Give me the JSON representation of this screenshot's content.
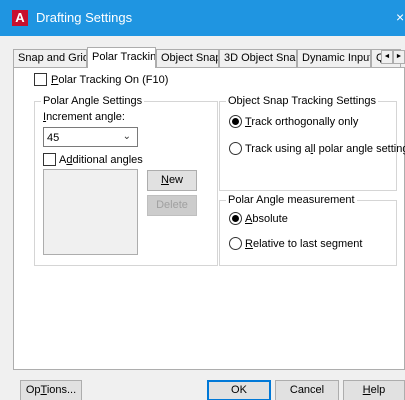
{
  "window": {
    "title": "Drafting Settings",
    "app_icon_letter": "A",
    "close_glyph": "×",
    "title_bar_color": "#1f95e1"
  },
  "tabs": [
    {
      "label": "Snap and Grid",
      "active": false
    },
    {
      "label": "Polar Tracking",
      "active": true
    },
    {
      "label": "Object Snap",
      "active": false
    },
    {
      "label": "3D Object Snap",
      "active": false
    },
    {
      "label": "Dynamic Input",
      "active": false
    },
    {
      "label": "Quic",
      "active": false
    }
  ],
  "tab_scroll": {
    "left": "◄",
    "right": "►"
  },
  "polar_tracking_on": {
    "checked": false,
    "mnemonic": "P",
    "rest": "olar Tracking On (F10)"
  },
  "polar_angle_settings": {
    "title": "Polar Angle Settings",
    "increment_label_mnemonic": "I",
    "increment_label_rest": "ncrement angle:",
    "increment_value": "45",
    "additional_angles": {
      "checked": false,
      "prefix": "A",
      "mnemonic": "d",
      "rest": "ditional angles"
    },
    "new_button": {
      "mnemonic": "N",
      "rest": "ew"
    },
    "delete_button": {
      "label": "Delete",
      "enabled": false
    }
  },
  "object_snap_tracking": {
    "title": "Object Snap Tracking Settings",
    "options": [
      {
        "prefix": "",
        "mnemonic": "T",
        "rest": "rack orthogonally only",
        "selected": true
      },
      {
        "prefix": "Track using a",
        "mnemonic": "l",
        "rest": "l polar angle settings",
        "selected": false
      }
    ]
  },
  "polar_angle_measurement": {
    "title": "Polar Angle measurement",
    "options": [
      {
        "mnemonic": "A",
        "rest": "bsolute",
        "selected": true
      },
      {
        "mnemonic": "R",
        "rest": "elative to last segment",
        "selected": false
      }
    ]
  },
  "footer": {
    "options_button": {
      "mnemonic": "T",
      "prefix": "Op",
      "rest": "ions..."
    },
    "ok_label": "OK",
    "cancel_label": "Cancel",
    "help_button": {
      "mnemonic": "H",
      "rest": "elp"
    }
  }
}
